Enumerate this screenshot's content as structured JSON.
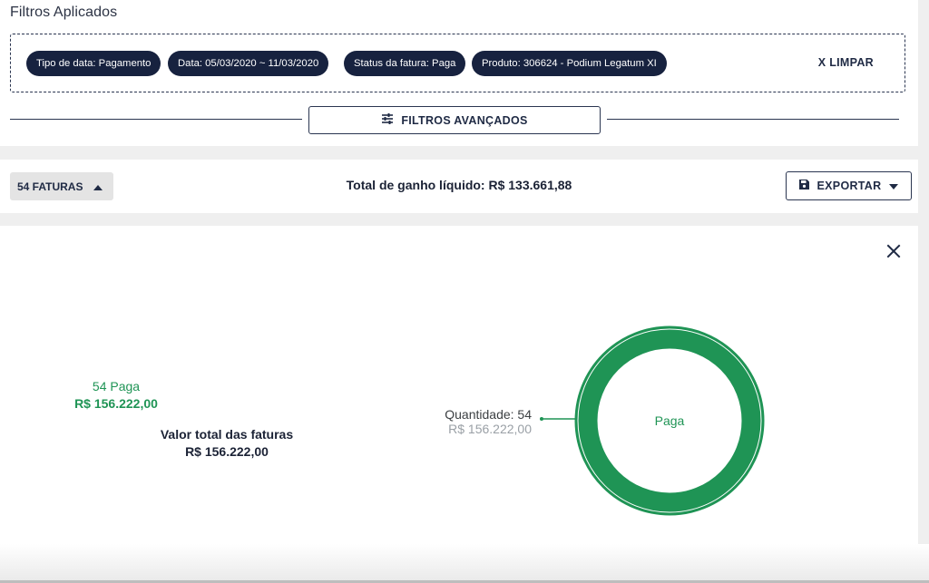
{
  "filters": {
    "title": "Filtros Aplicados",
    "chips": [
      "Tipo de data: Pagamento",
      "Data: 05/03/2020 ~ 11/03/2020",
      "Status da fatura: Paga",
      "Produto: 306624 - Podium Legatum XI"
    ],
    "clear_label": "X LIMPAR",
    "advanced_label": "FILTROS AVANÇADOS"
  },
  "toolbar": {
    "invoice_count_label": "54 FATURAS",
    "total_text": "Total de ganho líquido: R$ 133.661,88",
    "export_label": "EXPORTAR"
  },
  "summary": {
    "status_line": "54 Paga",
    "status_amount": "R$ 156.222,00",
    "total_label": "Valor total das faturas",
    "total_amount": "R$ 156.222,00"
  },
  "chart_data": {
    "type": "pie",
    "categories": [
      "Paga"
    ],
    "values": [
      54
    ],
    "amounts": [
      "R$ 156.222,00"
    ],
    "center_label": "Paga",
    "callout": {
      "quantity": "Quantidade: 54",
      "amount": "R$ 156.222,00"
    }
  },
  "colors": {
    "primary": "#17223f",
    "paid": "#1f9455",
    "muted": "#9aa0a6"
  },
  "icons": {
    "sliders": "sliders-icon",
    "caret_up": "caret-up-icon",
    "save": "save-icon",
    "caret_down": "caret-down-icon",
    "close": "close-icon"
  }
}
